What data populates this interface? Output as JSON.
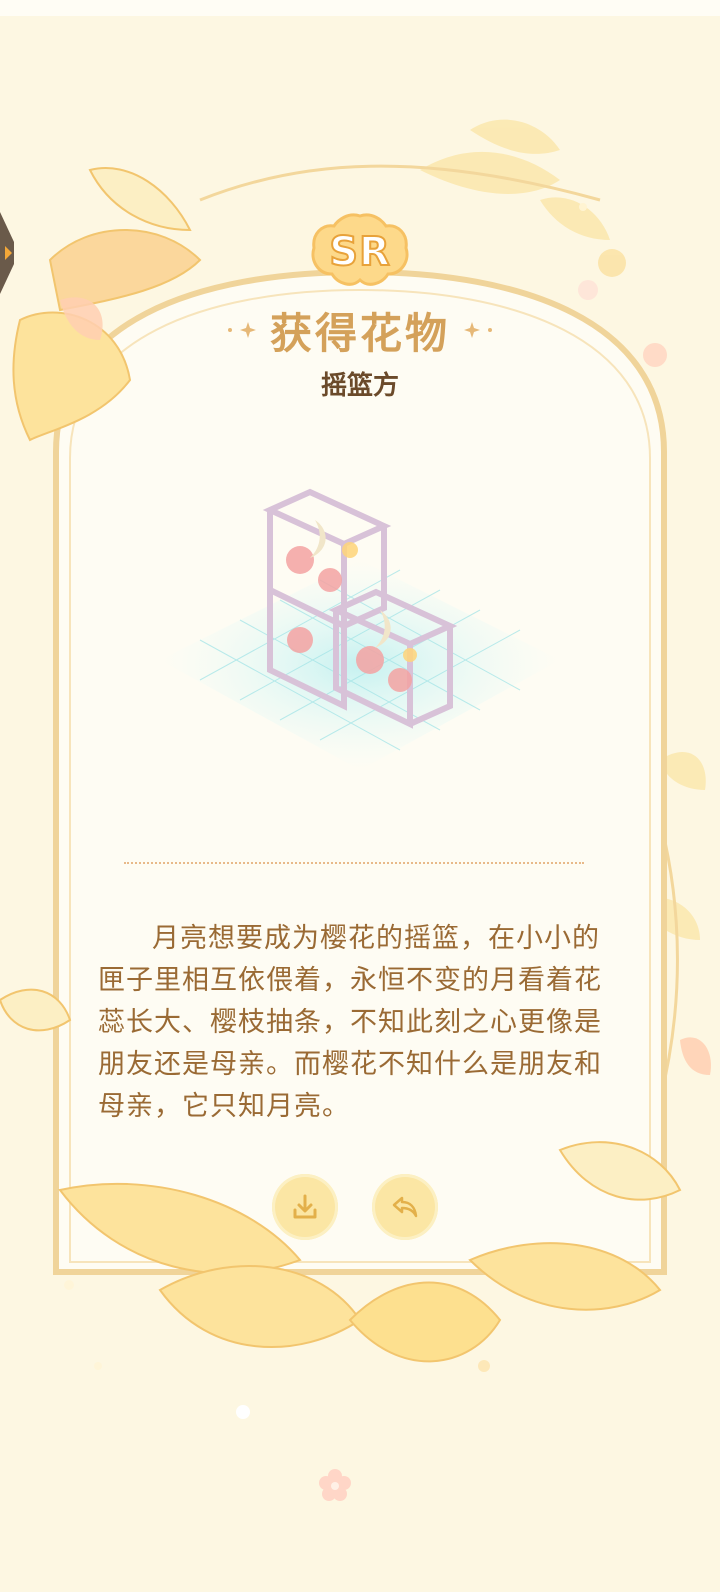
{
  "rarity": "SR",
  "header": {
    "title": "获得花物",
    "item_name": "摇篮方"
  },
  "description": "月亮想要成为樱花的摇篮，在小小的匣子里相互依偎着，永恒不变的月看着花蕊长大、樱枝抽条，不知此刻之心更像是朋友还是母亲。而樱花不知什么是朋友和母亲，它只知月亮。",
  "actions": {
    "download_icon": "download-icon",
    "share_icon": "share-icon"
  },
  "colors": {
    "background": "#fdf7e2",
    "title": "#d4a15a",
    "item_name": "#6b4a2a",
    "description": "#9a6a34",
    "frame": "#f0d49a",
    "button": "#fbe6a4"
  }
}
